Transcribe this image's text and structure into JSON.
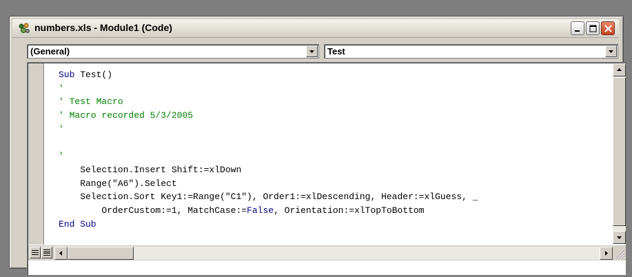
{
  "window": {
    "title": "numbers.xls - Module1 (Code)"
  },
  "object_combo": {
    "value": "(General)"
  },
  "procedure_combo": {
    "value": "Test"
  },
  "code_lines": [
    {
      "parts": [
        {
          "t": "Sub",
          "c": "kw"
        },
        {
          "t": " Test()",
          "c": ""
        }
      ]
    },
    {
      "parts": [
        {
          "t": "'",
          "c": "cm"
        }
      ]
    },
    {
      "parts": [
        {
          "t": "' Test Macro",
          "c": "cm"
        }
      ]
    },
    {
      "parts": [
        {
          "t": "' Macro recorded 5/3/2005",
          "c": "cm"
        }
      ]
    },
    {
      "parts": [
        {
          "t": "'",
          "c": "cm"
        }
      ]
    },
    {
      "parts": [
        {
          "t": "",
          "c": ""
        }
      ]
    },
    {
      "parts": [
        {
          "t": "'",
          "c": "cm"
        }
      ]
    },
    {
      "parts": [
        {
          "t": "    Selection.Insert Shift:=xlDown",
          "c": ""
        }
      ]
    },
    {
      "parts": [
        {
          "t": "    Range(\"A6\").Select",
          "c": ""
        }
      ]
    },
    {
      "parts": [
        {
          "t": "    Selection.Sort Key1:=Range(\"C1\"), Order1:=xlDescending, Header:=xlGuess, _",
          "c": ""
        }
      ]
    },
    {
      "parts": [
        {
          "t": "        OrderCustom:=1, MatchCase:=",
          "c": ""
        },
        {
          "t": "False",
          "c": "kw"
        },
        {
          "t": ", Orientation:=xlTopToBottom",
          "c": ""
        }
      ]
    },
    {
      "parts": [
        {
          "t": "End Sub",
          "c": "kw"
        }
      ]
    }
  ],
  "icons": {
    "app": "vba-module-icon",
    "minimize": "minimize-icon",
    "maximize": "maximize-icon",
    "close": "close-icon",
    "dropdown": "chevron-down-icon",
    "scroll_up": "arrow-up-icon",
    "scroll_down": "arrow-down-icon",
    "scroll_left": "arrow-left-icon",
    "scroll_right": "arrow-right-icon",
    "procedure_view": "procedure-view-icon",
    "full_module_view": "full-module-view-icon",
    "resize_grip": "resize-grip-icon"
  },
  "colors": {
    "keyword": "#00007f",
    "comment": "#008000",
    "close_button": "#c3421f"
  }
}
